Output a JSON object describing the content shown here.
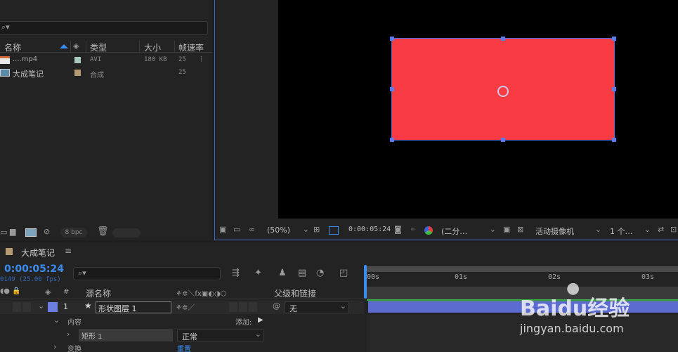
{
  "project": {
    "columns": {
      "name": "名称",
      "type": "类型",
      "size": "大小",
      "fps": "帧速率"
    },
    "items": [
      {
        "name": "....mp4",
        "type": "AVI",
        "size": "180 KB",
        "fps": "25",
        "swatch": "#a7c9c0"
      },
      {
        "name": "大成笔记",
        "type": "合成",
        "size": "",
        "fps": "25",
        "swatch": "#b59b72"
      }
    ],
    "bpc": "8 bpc"
  },
  "viewer": {
    "zoom": "(50%)",
    "timecode": "0:00:05:24",
    "resolution": "(二分…",
    "camera": "活动摄像机",
    "views": "1 个…",
    "shape_color": "#f93c44"
  },
  "timeline": {
    "comp_name": "大成笔记",
    "menu_glyph": "≡",
    "timecode": "0:00:05:24",
    "frame_info": "0149 (25.00 fps)",
    "headers": {
      "num": "#",
      "source": "源名称",
      "parent": "父级和链接"
    },
    "layer": {
      "index": "1",
      "name": "形状图层 1",
      "parent": "无"
    },
    "contents_label": "内容",
    "add_label": "添加:",
    "rect_label": "矩形 1",
    "blend_mode": "正常",
    "transform_label": "变换",
    "reset_label": "重置",
    "ruler": [
      "00s",
      "01s",
      "02s",
      "03s"
    ]
  },
  "watermark": {
    "brand": "Baidu经验",
    "url": "jingyan.baidu.com"
  }
}
